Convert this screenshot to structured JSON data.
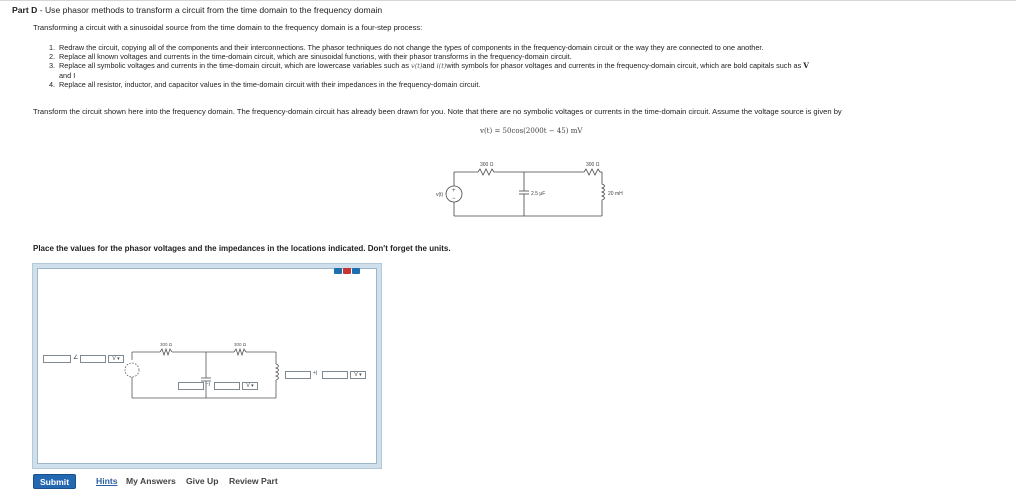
{
  "header": {
    "part_label": "Part D",
    "part_title": " - Use phasor methods to transform a circuit from the time domain to the frequency domain"
  },
  "intro": "Transforming a circuit with a sinusoidal source from the time domain to the frequency domain is a four-step process:",
  "steps": [
    {
      "num": "1.",
      "text": "Redraw the circuit, copying all of the components and their interconnections. The phasor techniques do not change the types of components in the frequency-domain circuit or the way they are connected to one another."
    },
    {
      "num": "2.",
      "text": "Replace all known voltages and currents in the time-domain circuit, which are sinusoidal functions, with their phasor transforms in the frequency-domain circuit."
    },
    {
      "num": "3.",
      "text_a": "Replace all symbolic voltages and currents in the time-domain circuit, which are lowercase variables such as ",
      "sym_v": "v(t)",
      "text_b": "and ",
      "sym_i": "i(t)",
      "text_c": "with symbols for phasor voltages and currents in the frequency-domain circuit, which are bold capitals such as ",
      "sym_V": "V",
      "cont": "and I"
    },
    {
      "num": "4.",
      "text": "Replace all resistor, inductor, and capacitor values in the time-domain circuit with their impedances in the frequency-domain circuit."
    }
  ],
  "transform_text": "Transform the circuit shown here into the frequency domain. The frequency-domain circuit has already been drawn for you. Note that there are no symbolic voltages or currents in the time-domain circuit. Assume the voltage source is given by",
  "source_equation": "v(t) = 50cos(2000t − 45) mV",
  "circuit1": {
    "r1_label": "300 Ω",
    "r2_label": "300 Ω",
    "cap_label": "2.5 μF",
    "ind_label": "20 mH",
    "source_label": "v(t)"
  },
  "place_text": "Place the values for the phasor voltages and the impedances in the locations indicated. Don't forget the units.",
  "circuit2": {
    "r1_label": "300 Ω",
    "r2_label": "300 Ω",
    "angle_symbol": "∠",
    "j_symbol": "+j",
    "minus_j_symbol": "−j",
    "unit_box": "V ▾"
  },
  "colors": {
    "accent": "#2468b2",
    "applet_border": "#cfe0ec",
    "mini_red": "#c63535"
  },
  "actions": {
    "submit": "Submit",
    "hints": "Hints",
    "my_answers": "My Answers",
    "give_up": "Give Up",
    "review_part": "Review Part"
  }
}
